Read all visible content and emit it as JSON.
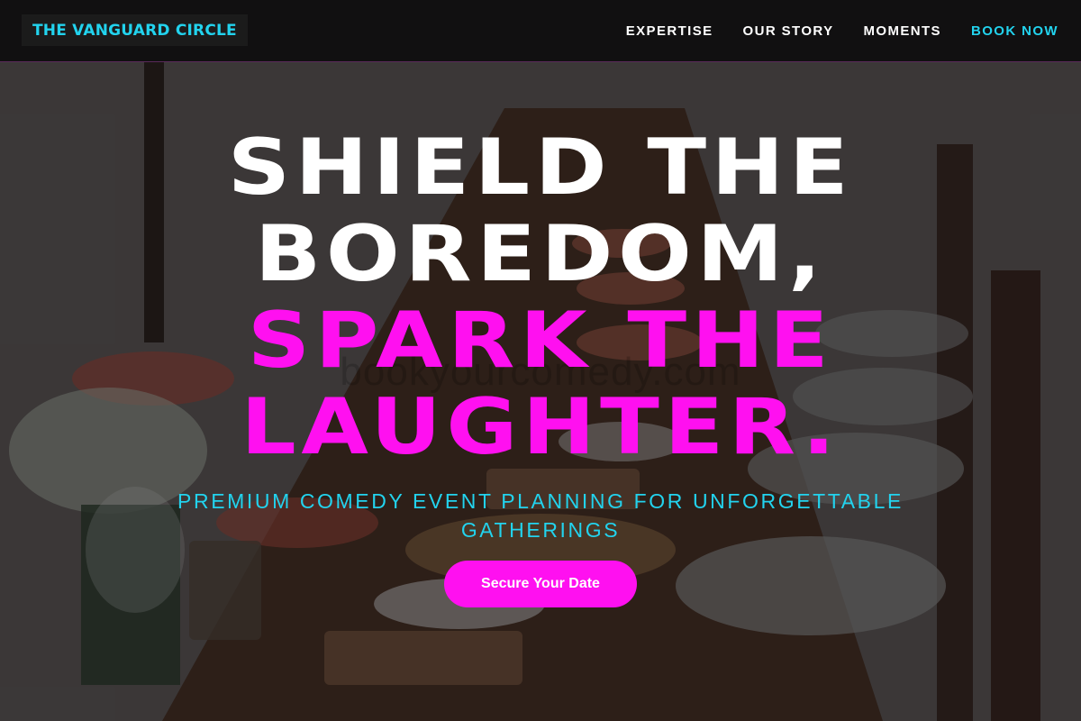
{
  "brand": {
    "logo_text": "THE VANGUARD CIRCLE",
    "accent_color": "#22d3ee",
    "highlight_color": "#ff10f0"
  },
  "nav": {
    "items": [
      {
        "label": "EXPERTISE"
      },
      {
        "label": "OUR STORY"
      },
      {
        "label": "MOMENTS"
      },
      {
        "label": "BOOK NOW"
      }
    ]
  },
  "hero": {
    "headline_line_1": "SHIELD THE",
    "headline_line_2": "BOREDOM,",
    "headline_line_3": "SPARK THE",
    "headline_line_4": "LAUGHTER.",
    "watermark": "bookyourcomedy.com",
    "subtitle": "PREMIUM COMEDY EVENT PLANNING FOR UNFORGETTABLE GATHERINGS",
    "cta_label": "Secure Your Date"
  }
}
